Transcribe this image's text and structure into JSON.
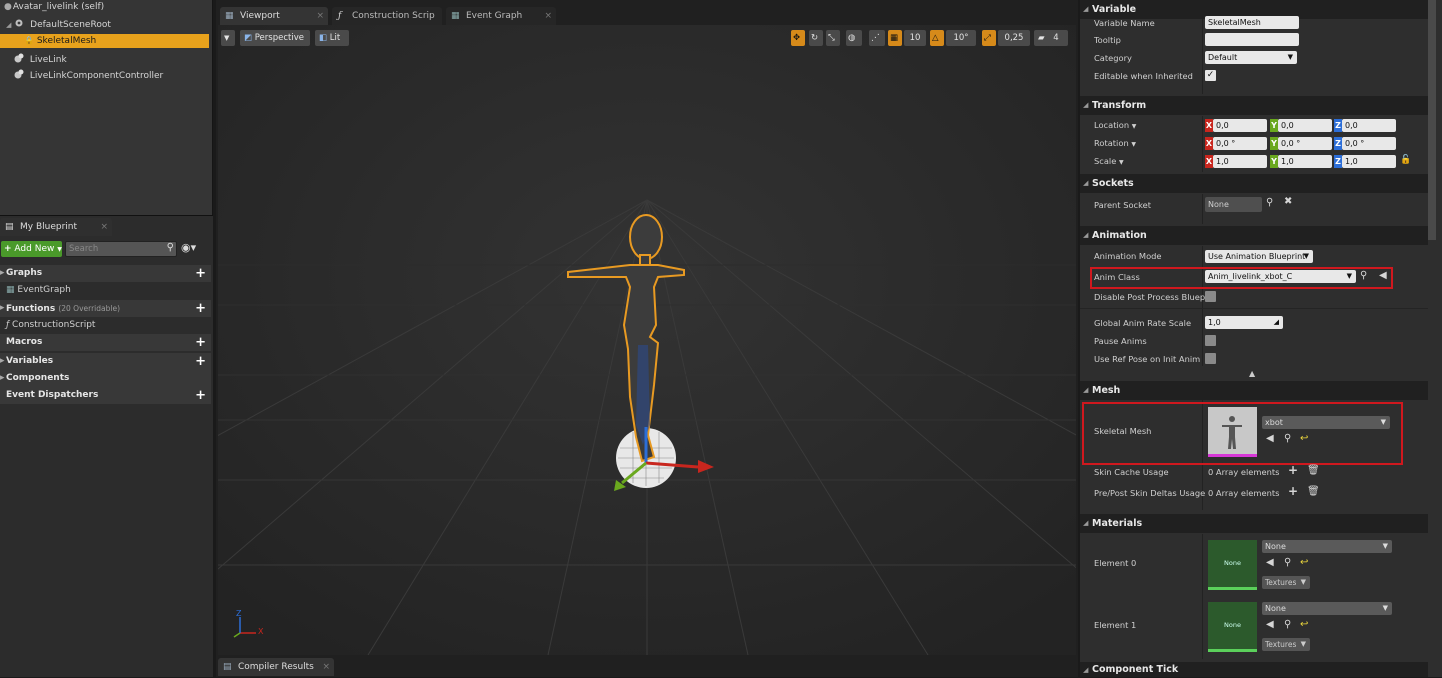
{
  "components": {
    "root_title": "Avatar_livelink (self)",
    "items": [
      {
        "label": "DefaultSceneRoot"
      },
      {
        "label": "SkeletalMesh"
      },
      {
        "label": "LiveLink"
      },
      {
        "label": "LiveLinkComponentController"
      }
    ]
  },
  "my_blueprint": {
    "tab_label": "My Blueprint",
    "add_new_label": "Add New",
    "search_placeholder": "Search",
    "sections": {
      "graphs": "Graphs",
      "event_graph": "EventGraph",
      "functions": "Functions",
      "functions_note": "(20 Overridable)",
      "construction_script": "ConstructionScript",
      "macros": "Macros",
      "variables": "Variables",
      "components": "Components",
      "event_dispatchers": "Event Dispatchers"
    }
  },
  "editor_tabs": [
    {
      "label": "Viewport"
    },
    {
      "label": "Construction Scrip"
    },
    {
      "label": "Event Graph"
    }
  ],
  "viewport": {
    "perspective_label": "Perspective",
    "lit_label": "Lit",
    "grid_snap": "10",
    "rotation_snap": "10°",
    "scale_snap": "0,25",
    "camera_speed": "4",
    "axis_x": "X",
    "axis_z": "Z"
  },
  "bottom_tab": "Compiler Results",
  "details": {
    "variable": {
      "title": "Variable",
      "name_label": "Variable Name",
      "name_value": "SkeletalMesh",
      "tooltip_label": "Tooltip",
      "tooltip_value": "",
      "category_label": "Category",
      "category_value": "Default",
      "editable_label": "Editable when Inherited"
    },
    "transform": {
      "title": "Transform",
      "location_label": "Location",
      "rotation_label": "Rotation",
      "scale_label": "Scale",
      "loc": [
        "0,0",
        "0,0",
        "0,0"
      ],
      "rot": [
        "0,0 °",
        "0,0 °",
        "0,0 °"
      ],
      "scale": [
        "1,0",
        "1,0",
        "1,0"
      ],
      "axis_x": "X",
      "axis_y": "Y",
      "axis_z": "Z"
    },
    "sockets": {
      "title": "Sockets",
      "parent_label": "Parent Socket",
      "parent_value": "None"
    },
    "animation": {
      "title": "Animation",
      "mode_label": "Animation Mode",
      "mode_value": "Use Animation Blueprint",
      "class_label": "Anim Class",
      "class_value": "Anim_livelink_xbot_C",
      "disable_pp_label": "Disable Post Process Bluepri",
      "rate_label": "Global Anim Rate Scale",
      "rate_value": "1,0",
      "pause_label": "Pause Anims",
      "ref_pose_label": "Use Ref Pose on Init Anim"
    },
    "mesh": {
      "title": "Mesh",
      "skel_label": "Skeletal Mesh",
      "skel_value": "xbot",
      "skin_cache_label": "Skin Cache Usage",
      "skin_cache_value": "0 Array elements",
      "skin_deltas_label": "Pre/Post Skin Deltas Usage",
      "skin_deltas_value": "0 Array elements"
    },
    "materials": {
      "title": "Materials",
      "el0_label": "Element 0",
      "el0_value": "None",
      "el1_label": "Element 1",
      "el1_value": "None",
      "thumb_label": "None",
      "textures_label": "Textures"
    },
    "component_tick": {
      "title": "Component Tick"
    }
  },
  "colors": {
    "selection": "#e8a21c",
    "highlight_box": "#d0181e",
    "axis_x": "#c8261e",
    "axis_y": "#6aa81e",
    "axis_z": "#2c6ed8"
  }
}
